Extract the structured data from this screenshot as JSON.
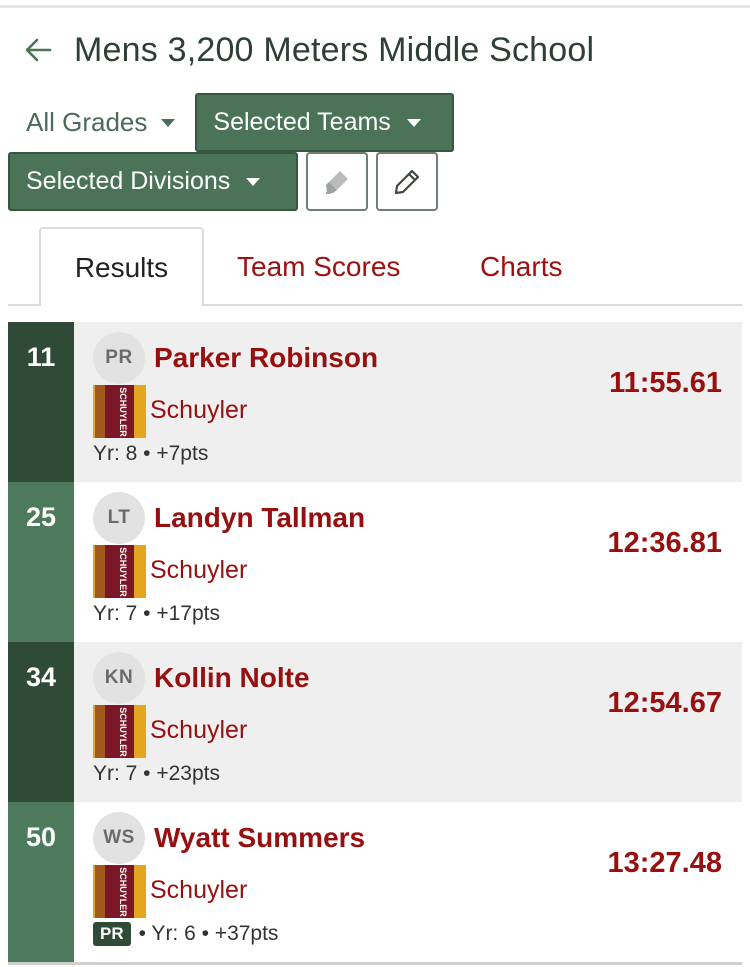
{
  "header": {
    "title": "Mens 3,200 Meters Middle School"
  },
  "filters": {
    "grades_label": "All Grades",
    "teams_label": "Selected Teams",
    "divisions_label": "Selected Divisions"
  },
  "tabs": [
    {
      "label": "Results",
      "active": true
    },
    {
      "label": "Team Scores",
      "active": false
    },
    {
      "label": "Charts",
      "active": false
    }
  ],
  "colors": {
    "accent_green": "#4a7358",
    "dark_green": "#2f4b37",
    "maroon": "#970f0f"
  },
  "results": [
    {
      "place": "11",
      "initials": "PR",
      "name": "Parker Robinson",
      "team": "Schuyler",
      "meta": "Yr: 8 • +7pts",
      "time": "11:55.61",
      "badge": ""
    },
    {
      "place": "25",
      "initials": "LT",
      "name": "Landyn Tallman",
      "team": "Schuyler",
      "meta": "Yr: 7 • +17pts",
      "time": "12:36.81",
      "badge": ""
    },
    {
      "place": "34",
      "initials": "KN",
      "name": "Kollin Nolte",
      "team": "Schuyler",
      "meta": "Yr: 7 • +23pts",
      "time": "12:54.67",
      "badge": ""
    },
    {
      "place": "50",
      "initials": "WS",
      "name": "Wyatt Summers",
      "team": "Schuyler",
      "meta": "• Yr: 6 • +37pts",
      "time": "13:27.48",
      "badge": "PR"
    }
  ],
  "logo_text": "SCHUYLER"
}
